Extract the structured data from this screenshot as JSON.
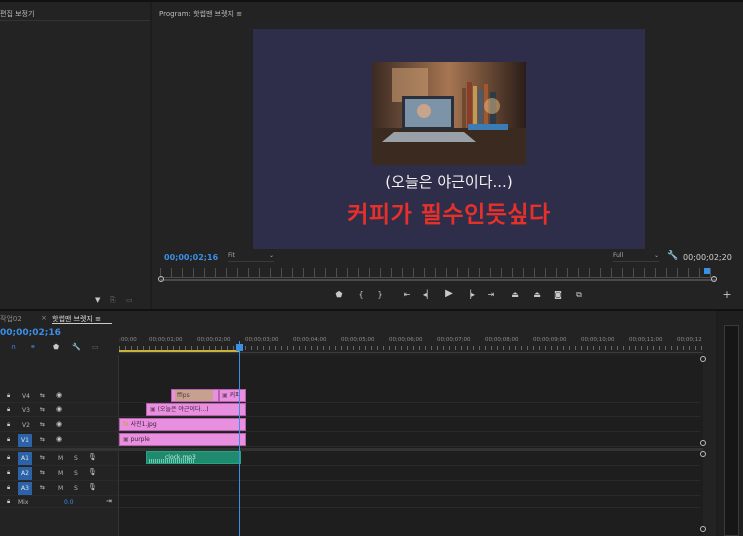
{
  "source_panel": {
    "title": "편집 보정기"
  },
  "program": {
    "title": "Program: 핫썹맨 브렛지 ≡",
    "caption_line1": "(오늘은 야근이다...)",
    "caption_line2": "커피가 필수인듯싶다",
    "timecode_current": "00;00;02;16",
    "fit_label": "Fit",
    "full_label": "Full",
    "timecode_duration": "00;00;02;20"
  },
  "timeline": {
    "tab_left": "작업02",
    "tab_active": "핫썹맨 브렛지 ≡",
    "timecode": "00;00;02;16",
    "ruler": [
      ":00;00",
      "00;00;01;00",
      "00;00;02;00",
      "00;00;03;00",
      "00;00;04;00",
      "00;00;05;00",
      "00;00;06;00",
      "00;00;07;00",
      "00;00;08;00",
      "00;00;09;00",
      "00;00;10;00",
      "00;00;11;00",
      "00;00;12"
    ],
    "tracks": {
      "v4": "V4",
      "v3": "V3",
      "v2": "V2",
      "v1": "V1",
      "a1": "A1",
      "a2": "A2",
      "a3": "A3",
      "mix": "Mix",
      "mix_value": "0.0",
      "mute": "M",
      "solo": "S"
    },
    "clips": {
      "v4_a": "ffips",
      "v4_b": "커피",
      "v3": "(오늘은 야근이다...)",
      "v2": "사진1.jpg",
      "v1": "purple",
      "a1": "clock.mp3"
    }
  },
  "colors": {
    "accent_blue": "#3b8fe6",
    "clip_pink": "#e88fe0",
    "audio_green": "#1f8a6e",
    "caption_red": "#e8302a"
  }
}
